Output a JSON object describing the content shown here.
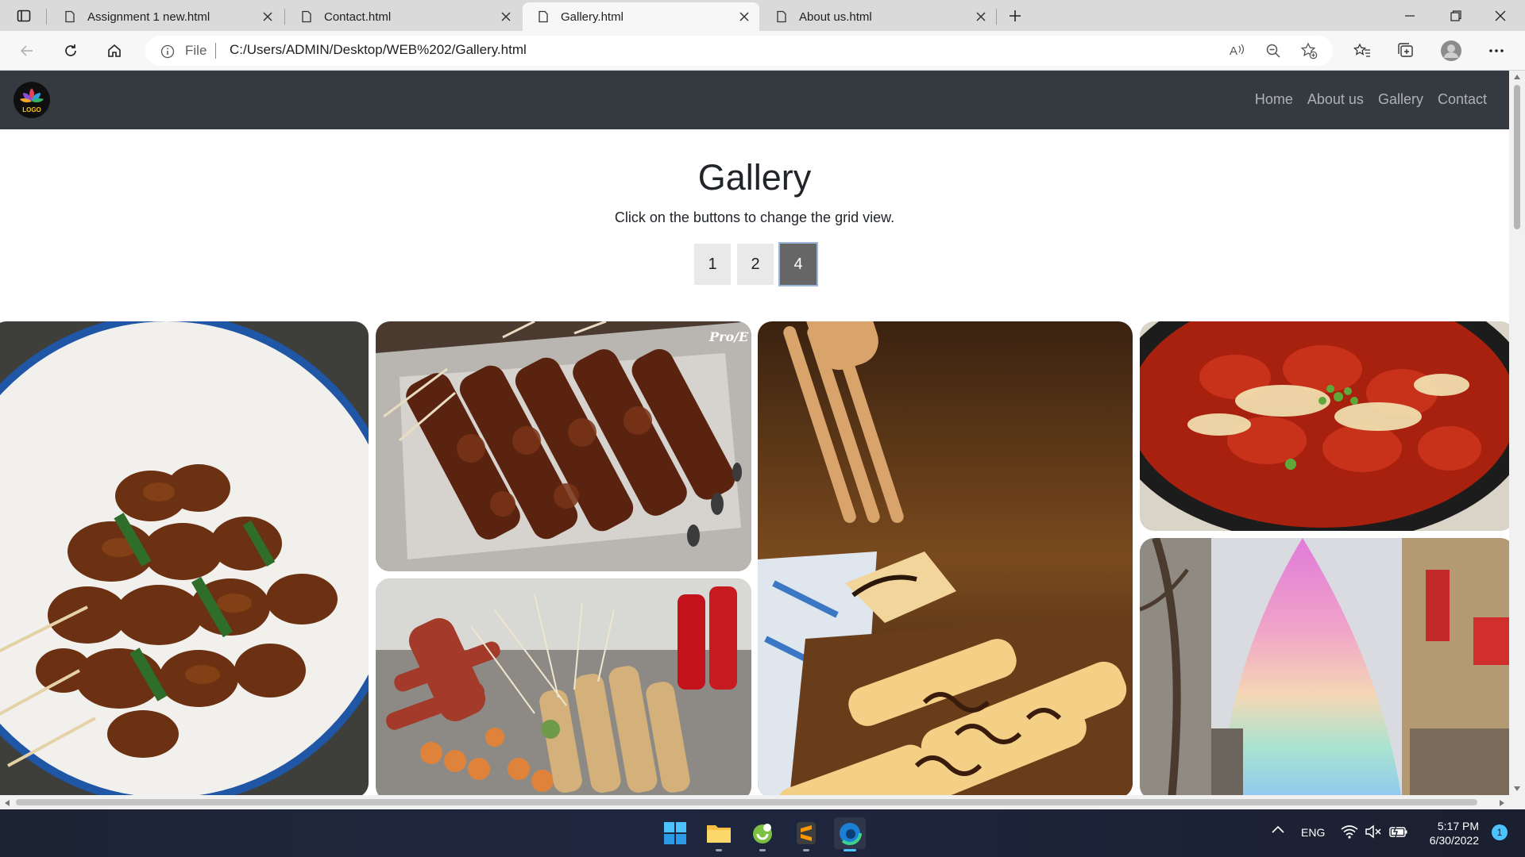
{
  "browser": {
    "tabs": [
      {
        "title": "Assignment 1 new.html",
        "active": false
      },
      {
        "title": "Contact.html",
        "active": false
      },
      {
        "title": "Gallery.html",
        "active": true
      },
      {
        "title": "About us.html",
        "active": false
      }
    ],
    "address": {
      "scheme_label": "File",
      "url": "C:/Users/ADMIN/Desktop/WEB%202/Gallery.html"
    }
  },
  "page": {
    "navbar": {
      "logo_text": "LOGO",
      "links": [
        "Home",
        "About us",
        "Gallery",
        "Contact"
      ]
    },
    "title": "Gallery",
    "subtitle": "Click on the buttons to change the grid view.",
    "grid_buttons": [
      {
        "label": "1",
        "active": false
      },
      {
        "label": "2",
        "active": false
      },
      {
        "label": "4",
        "active": true
      }
    ],
    "photos": [
      {
        "subject": "Glazed chicken skewers on a blue-rimmed plate"
      },
      {
        "subject": "Yakitori skewers on foil tray",
        "watermark": "Pro/E"
      },
      {
        "subject": "Street food sausage and tempura skewers"
      },
      {
        "subject": "Fork lifting chocolate-drizzled crepe"
      },
      {
        "subject": "Cheesy spicy rice cakes in black pan"
      },
      {
        "subject": "Rainbow cotton candy on a shopping street"
      }
    ]
  },
  "taskbar": {
    "language": "ENG",
    "time": "5:17 PM",
    "date": "6/30/2022",
    "notifications": "1"
  },
  "colors": {
    "navbar": "#343a40",
    "active_button": "#666666",
    "taskbar": "#1d2433"
  }
}
